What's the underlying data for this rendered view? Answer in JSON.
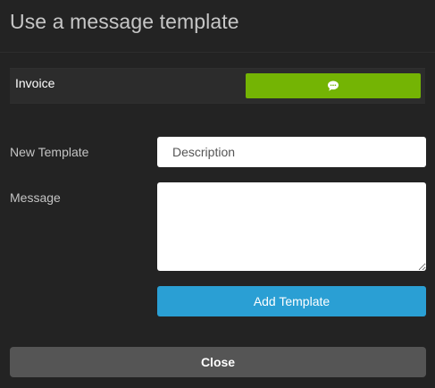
{
  "dialog": {
    "title": "Use a message template"
  },
  "templates": {
    "items": [
      {
        "name": "Invoice",
        "action_icon": "chat-bubble-icon"
      }
    ]
  },
  "form": {
    "new_template_label": "New Template",
    "description_placeholder": "Description",
    "description_value": "",
    "message_label": "Message",
    "message_value": "",
    "add_button_label": "Add Template"
  },
  "footer": {
    "close_label": "Close"
  },
  "colors": {
    "background": "#232323",
    "use_button": "#74b404",
    "add_button": "#2a9fd4",
    "close_button": "#555555"
  }
}
